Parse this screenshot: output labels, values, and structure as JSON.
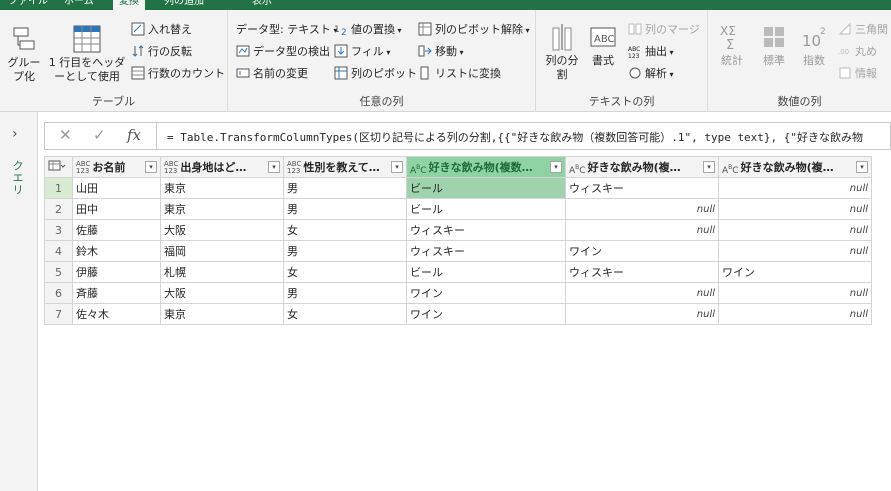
{
  "tabs": [
    "ファイル",
    "ホーム",
    "変換",
    "列の追加",
    "表示"
  ],
  "ribbon": {
    "table_group": {
      "label": "テーブル",
      "group_by": "グループ化",
      "use_first_row": "1 行目をヘッダーとして使用",
      "transpose": "入れ替え",
      "reverse_rows": "行の反転",
      "count_rows": "行数のカウント"
    },
    "any_column_group": {
      "label": "任意の列",
      "data_type": "データ型: テキスト",
      "detect_type": "データ型の検出",
      "rename": "名前の変更",
      "replace_values": "値の置換",
      "fill": "フィル",
      "pivot": "列のピボット",
      "unpivot": "列のピボット解除",
      "move": "移動",
      "convert_to_list": "リストに変換"
    },
    "text_column_group": {
      "label": "テキストの列",
      "split_column": "列の分割",
      "format": "書式",
      "merge_columns": "列のマージ",
      "extract": "抽出",
      "parse": "解析"
    },
    "number_column_group": {
      "label": "数値の列",
      "statistics": "統計",
      "standard": "標準",
      "scientific": "指数",
      "trigonometry": "三角関",
      "rounding": "丸め",
      "information": "情報"
    }
  },
  "query_pane": {
    "label": "クエリ"
  },
  "formula_bar": {
    "fx": "fx",
    "formula": "= Table.TransformColumnTypes(区切り記号による列の分割,{{\"好きな飲み物（複数回答可能）.1\", type text}, {\"好きな飲み物"
  },
  "table": {
    "columns": [
      "お名前",
      "出身地はど…",
      "性別を教えて…",
      "好きな飲み物(複数…",
      "好きな飲み物(複…",
      "好きな飲み物(複…"
    ],
    "type_badges": [
      "ABC\n123",
      "ABC\n123",
      "ABC\n123",
      "ABC",
      "ABC",
      "ABC"
    ],
    "rows": [
      [
        "1",
        "山田",
        "東京",
        "男",
        "ビール",
        "ウィスキー",
        "null"
      ],
      [
        "2",
        "田中",
        "東京",
        "男",
        "ビール",
        "null",
        "null"
      ],
      [
        "3",
        "佐藤",
        "大阪",
        "女",
        "ウィスキー",
        "null",
        "null"
      ],
      [
        "4",
        "鈴木",
        "福岡",
        "男",
        "ウィスキー",
        "ワイン",
        "null"
      ],
      [
        "5",
        "伊藤",
        "札幌",
        "女",
        "ビール",
        "ウィスキー",
        "ワイン"
      ],
      [
        "6",
        "斉藤",
        "大阪",
        "男",
        "ワイン",
        "null",
        "null"
      ],
      [
        "7",
        "佐々木",
        "東京",
        "女",
        "ワイン",
        "null",
        "null"
      ]
    ]
  },
  "colors": {
    "accent": "#217346",
    "selected_header": "#8fd3a4",
    "selected_cell": "#9ed3ae"
  }
}
